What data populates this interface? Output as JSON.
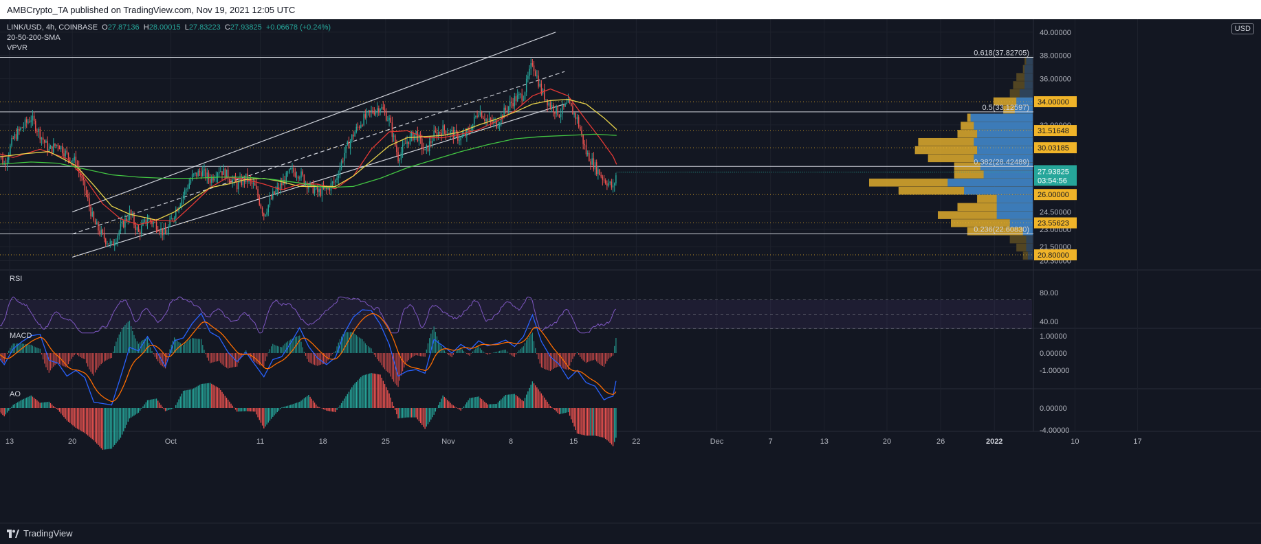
{
  "header": {
    "publisher": "AMBCrypto_TA published on TradingView.com, Nov 19, 2021 12:05 UTC"
  },
  "legend": {
    "symbol": "LINK/USD, 4h, COINBASE",
    "o_label": "O",
    "o": "27.87136",
    "h_label": "H",
    "h": "28.00015",
    "l_label": "L",
    "l": "27.83223",
    "c_label": "C",
    "c": "27.93825",
    "change": "+0.06678 (+0.24%)",
    "ma": "20-50-200-SMA",
    "vpvr": "VPVR"
  },
  "currency": "USD",
  "footer": {
    "brand": "TradingView"
  },
  "colors": {
    "bg": "#131722",
    "up": "#26a69a",
    "down": "#ef5350",
    "sma20": "#e53935",
    "sma50": "#e8d34b",
    "sma200": "#43c743",
    "level": "#f0b429",
    "vp_gold": "#d4a32c",
    "vp_blue": "#2d78c8"
  },
  "chart_data": {
    "type": "candlestick",
    "symbol": "LINK/USD",
    "timeframe": "4h",
    "exchange": "COINBASE",
    "last_price": "27.93825",
    "countdown": "03:54:56",
    "x_axis_labels": [
      "13",
      "20",
      "Oct",
      "11",
      "18",
      "25",
      "Nov",
      "8",
      "15",
      "22",
      "Dec",
      "7",
      "13",
      "20",
      "26",
      "2022",
      "10",
      "17"
    ],
    "x_axis_days": [
      -18,
      -11,
      0,
      10,
      17,
      24,
      31,
      38,
      45,
      52,
      61,
      67,
      73,
      80,
      86,
      92,
      101,
      108
    ],
    "price_axis_labels": [
      "40.00000",
      "38.00000",
      "36.00000",
      "32.00000",
      "24.50000",
      "23.00000",
      "21.50000",
      "20.30000"
    ],
    "price_axis_values": [
      40,
      38,
      36,
      32,
      24.5,
      23,
      21.5,
      20.3
    ],
    "y_range": [
      19.5,
      40.4
    ],
    "price_path": [
      [
        -19.6,
        30.2
      ],
      [
        -18.6,
        28.6
      ],
      [
        -17.6,
        30.8
      ],
      [
        -16.6,
        31.8
      ],
      [
        -15.6,
        32.6
      ],
      [
        -14.6,
        31.2
      ],
      [
        -13.6,
        29.8
      ],
      [
        -12.6,
        30.4
      ],
      [
        -11.6,
        29.4
      ],
      [
        -10.6,
        28.8
      ],
      [
        -9.6,
        26.4
      ],
      [
        -8.6,
        23.6
      ],
      [
        -7.6,
        22.4
      ],
      [
        -6.6,
        21.6
      ],
      [
        -5.6,
        23.1
      ],
      [
        -4.6,
        24.4
      ],
      [
        -3.6,
        22.7
      ],
      [
        -2.6,
        23.9
      ],
      [
        -1.6,
        23.4
      ],
      [
        -0.6,
        22.5
      ],
      [
        0.4,
        24.4
      ],
      [
        1.4,
        26.0
      ],
      [
        2.4,
        27.5
      ],
      [
        3.4,
        28.0
      ],
      [
        4.4,
        27.3
      ],
      [
        5.4,
        28.2
      ],
      [
        6.4,
        27.6
      ],
      [
        7.4,
        26.8
      ],
      [
        8.4,
        27.4
      ],
      [
        9.4,
        26.6
      ],
      [
        10.4,
        24.3
      ],
      [
        11.4,
        25.9
      ],
      [
        12.4,
        26.9
      ],
      [
        13.4,
        28.0
      ],
      [
        14.4,
        27.8
      ],
      [
        15.4,
        26.8
      ],
      [
        16.4,
        26.2
      ],
      [
        17.4,
        26.4
      ],
      [
        18.4,
        27.2
      ],
      [
        19.4,
        29.6
      ],
      [
        20.4,
        31.2
      ],
      [
        21.4,
        32.4
      ],
      [
        22.4,
        33.1
      ],
      [
        23.4,
        33.6
      ],
      [
        24.4,
        32.4
      ],
      [
        25.4,
        29.2
      ],
      [
        26.4,
        30.6
      ],
      [
        27.4,
        31.3
      ],
      [
        28.4,
        29.6
      ],
      [
        29.4,
        31.1
      ],
      [
        30.4,
        31.6
      ],
      [
        31.4,
        31.3
      ],
      [
        32.4,
        30.8
      ],
      [
        33.4,
        31.5
      ],
      [
        34.4,
        33.3
      ],
      [
        35.4,
        32.3
      ],
      [
        36.4,
        32.1
      ],
      [
        37.4,
        33.3
      ],
      [
        38.4,
        34.2
      ],
      [
        39.4,
        34.6
      ],
      [
        40.4,
        37.4
      ],
      [
        41.4,
        34.9
      ],
      [
        42.4,
        33.7
      ],
      [
        43.4,
        33.0
      ],
      [
        44.4,
        33.8
      ],
      [
        45.4,
        32.5
      ],
      [
        46.4,
        29.6
      ],
      [
        47.4,
        28.4
      ],
      [
        48.4,
        27.3
      ],
      [
        48.9,
        27.0
      ],
      [
        49.4,
        26.5
      ],
      [
        49.8,
        27.9
      ]
    ],
    "moving_averages": [
      {
        "name": "SMA 20",
        "color": "#e53935",
        "points": [
          [
            -19.6,
            29.6
          ],
          [
            -17.6,
            29.2
          ],
          [
            -14.6,
            29.9
          ],
          [
            -11.6,
            29.1
          ],
          [
            -9.6,
            27.4
          ],
          [
            -7.6,
            25.2
          ],
          [
            -5.6,
            23.9
          ],
          [
            -3.6,
            23.4
          ],
          [
            -1.6,
            23.8
          ],
          [
            0.4,
            23.7
          ],
          [
            2.4,
            25.1
          ],
          [
            4.4,
            26.6
          ],
          [
            6.4,
            27.5
          ],
          [
            8.4,
            27.3
          ],
          [
            10.4,
            26.9
          ],
          [
            12.4,
            26.4
          ],
          [
            14.4,
            26.9
          ],
          [
            16.4,
            26.9
          ],
          [
            18.4,
            26.5
          ],
          [
            20.4,
            27.6
          ],
          [
            22.4,
            29.9
          ],
          [
            24.4,
            31.4
          ],
          [
            26.4,
            31.5
          ],
          [
            28.4,
            30.9
          ],
          [
            30.4,
            30.9
          ],
          [
            32.4,
            31.2
          ],
          [
            34.4,
            31.6
          ],
          [
            36.4,
            32.3
          ],
          [
            38.4,
            33.2
          ],
          [
            40.4,
            34.5
          ],
          [
            42.4,
            35.1
          ],
          [
            44.4,
            34.5
          ],
          [
            46.4,
            32.4
          ],
          [
            47.9,
            30.9
          ],
          [
            49.4,
            29.3
          ],
          [
            49.8,
            28.6
          ]
        ]
      },
      {
        "name": "SMA 50",
        "color": "#e8d34b",
        "points": [
          [
            -19.6,
            29.2
          ],
          [
            -16.6,
            29.5
          ],
          [
            -13.6,
            29.7
          ],
          [
            -10.6,
            28.5
          ],
          [
            -8.6,
            26.8
          ],
          [
            -6.6,
            25.0
          ],
          [
            -4.6,
            24.3
          ],
          [
            -1.6,
            23.8
          ],
          [
            0.4,
            24.5
          ],
          [
            2.4,
            25.6
          ],
          [
            4.4,
            26.6
          ],
          [
            6.4,
            26.9
          ],
          [
            8.4,
            27.3
          ],
          [
            10.4,
            27.4
          ],
          [
            12.4,
            27.1
          ],
          [
            14.4,
            26.7
          ],
          [
            16.4,
            26.7
          ],
          [
            18.4,
            26.7
          ],
          [
            20.4,
            27.6
          ],
          [
            22.4,
            28.9
          ],
          [
            24.4,
            30.2
          ],
          [
            26.4,
            30.9
          ],
          [
            28.4,
            31.0
          ],
          [
            30.4,
            31.1
          ],
          [
            32.4,
            31.4
          ],
          [
            34.4,
            32.0
          ],
          [
            36.4,
            32.5
          ],
          [
            38.4,
            33.1
          ],
          [
            40.4,
            33.8
          ],
          [
            42.4,
            34.1
          ],
          [
            44.4,
            34.2
          ],
          [
            46.4,
            33.8
          ],
          [
            48.4,
            32.6
          ],
          [
            49.8,
            31.6
          ]
        ]
      },
      {
        "name": "SMA 200",
        "color": "#43c743",
        "points": [
          [
            -19.6,
            28.6
          ],
          [
            -15.6,
            28.8
          ],
          [
            -12.6,
            28.7
          ],
          [
            -9.6,
            28.2
          ],
          [
            -6.6,
            27.7
          ],
          [
            -3.6,
            27.5
          ],
          [
            -0.6,
            27.4
          ],
          [
            2.4,
            27.4
          ],
          [
            5.4,
            27.5
          ],
          [
            8.4,
            27.5
          ],
          [
            11.4,
            27.3
          ],
          [
            14.4,
            27.0
          ],
          [
            17.4,
            26.6
          ],
          [
            20.4,
            26.7
          ],
          [
            23.4,
            27.4
          ],
          [
            26.4,
            28.3
          ],
          [
            29.4,
            29.0
          ],
          [
            32.4,
            29.7
          ],
          [
            35.4,
            30.3
          ],
          [
            38.4,
            30.8
          ],
          [
            41.4,
            31.0
          ],
          [
            44.4,
            31.1
          ],
          [
            47.4,
            31.2
          ],
          [
            49.8,
            31.1
          ]
        ]
      }
    ],
    "fib_levels": [
      {
        "label": "0.618(37.82705)",
        "value": 37.82705
      },
      {
        "label": "0.5(33.12597)",
        "value": 33.12597
      },
      {
        "label": "0.382(28.42489)",
        "value": 28.42489
      },
      {
        "label": "0.236(22.60830)",
        "value": 22.6083
      }
    ],
    "horizontal_levels": [
      "34.00000",
      "31.51648",
      "30.03185",
      "26.00000",
      "23.55623",
      "20.80000"
    ],
    "channel": {
      "upper": [
        [
          -11,
          24.5
        ],
        [
          43,
          40.0
        ]
      ],
      "mid_dashed": [
        [
          -11,
          22.6
        ],
        [
          44,
          36.6
        ]
      ],
      "lower": [
        [
          -11,
          20.6
        ],
        [
          44,
          33.8
        ]
      ]
    },
    "volume_profile": [
      {
        "price": 37.5,
        "gold": 0.05,
        "blue": 0.04
      },
      {
        "price": 36.8,
        "gold": 0.06,
        "blue": 0.05
      },
      {
        "price": 36.1,
        "gold": 0.1,
        "blue": 0.05
      },
      {
        "price": 35.4,
        "gold": 0.12,
        "blue": 0.05
      },
      {
        "price": 34.7,
        "gold": 0.14,
        "blue": 0.08
      },
      {
        "price": 34.0,
        "gold": 0.24,
        "blue": 0.1
      },
      {
        "price": 33.3,
        "gold": 0.18,
        "blue": 0.11
      },
      {
        "price": 32.6,
        "gold": 0.4,
        "blue": 0.38
      },
      {
        "price": 31.9,
        "gold": 0.44,
        "blue": 0.36
      },
      {
        "price": 31.2,
        "gold": 0.46,
        "blue": 0.34
      },
      {
        "price": 30.5,
        "gold": 0.7,
        "blue": 0.36
      },
      {
        "price": 29.8,
        "gold": 0.72,
        "blue": 0.34
      },
      {
        "price": 29.1,
        "gold": 0.64,
        "blue": 0.36
      },
      {
        "price": 28.4,
        "gold": 0.48,
        "blue": 0.32
      },
      {
        "price": 27.7,
        "gold": 0.48,
        "blue": 0.3
      },
      {
        "price": 27.0,
        "gold": 1.0,
        "blue": 0.52
      },
      {
        "price": 26.3,
        "gold": 0.82,
        "blue": 0.42
      },
      {
        "price": 25.6,
        "gold": 0.34,
        "blue": 0.22
      },
      {
        "price": 24.9,
        "gold": 0.46,
        "blue": 0.22
      },
      {
        "price": 24.2,
        "gold": 0.58,
        "blue": 0.22
      },
      {
        "price": 23.5,
        "gold": 0.5,
        "blue": 0.14
      },
      {
        "price": 22.8,
        "gold": 0.4,
        "blue": 0.06
      },
      {
        "price": 22.1,
        "gold": 0.14,
        "blue": 0.04
      },
      {
        "price": 21.4,
        "gold": 0.1,
        "blue": 0.04
      },
      {
        "price": 20.7,
        "gold": 0.06,
        "blue": 0.03
      }
    ],
    "rsi": {
      "label": "RSI",
      "axis_labels": [
        "80.00",
        "40.00"
      ],
      "axis_values": [
        80,
        40
      ],
      "upper": 70,
      "lower": 30
    },
    "macd": {
      "label": "MACD",
      "axis_labels": [
        "1.00000",
        "0.00000",
        "-1.00000"
      ],
      "axis_values": [
        1,
        0,
        -1
      ]
    },
    "ao": {
      "label": "AO",
      "axis_labels": [
        "0.00000",
        "-4.00000"
      ],
      "axis_values": [
        0,
        -4
      ]
    }
  }
}
